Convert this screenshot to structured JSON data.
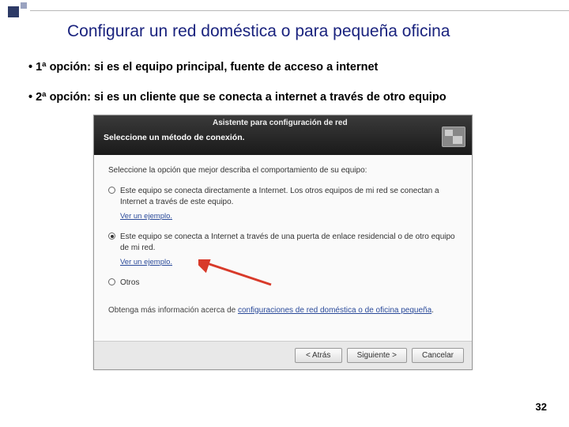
{
  "slide": {
    "title": "Configurar un red doméstica o para pequeña oficina",
    "bullet1": "1ª opción: si es el equipo principal, fuente de acceso a internet",
    "bullet2": "2ª opción: si es un cliente que se conecta a internet a través de otro equipo",
    "page_number": "32"
  },
  "wizard": {
    "window_title": "Asistente para configuración de red",
    "subtitle": "Seleccione un método de conexión.",
    "prompt": "Seleccione la opción que mejor describa el comportamiento de su equipo:",
    "option1": "Este equipo se conecta directamente a Internet. Los otros equipos de mi red se conectan a Internet a través de este equipo.",
    "example_link": "Ver un ejemplo.",
    "option2": "Este equipo se conecta a Internet a través de una puerta de enlace residencial o de otro equipo de mi red.",
    "option3": "Otros",
    "bottom_info_prefix": "Obtenga más información acerca de ",
    "bottom_info_link": "configuraciones de red doméstica o de oficina pequeña",
    "buttons": {
      "back": "< Atrás",
      "next": "Siguiente >",
      "cancel": "Cancelar"
    }
  }
}
